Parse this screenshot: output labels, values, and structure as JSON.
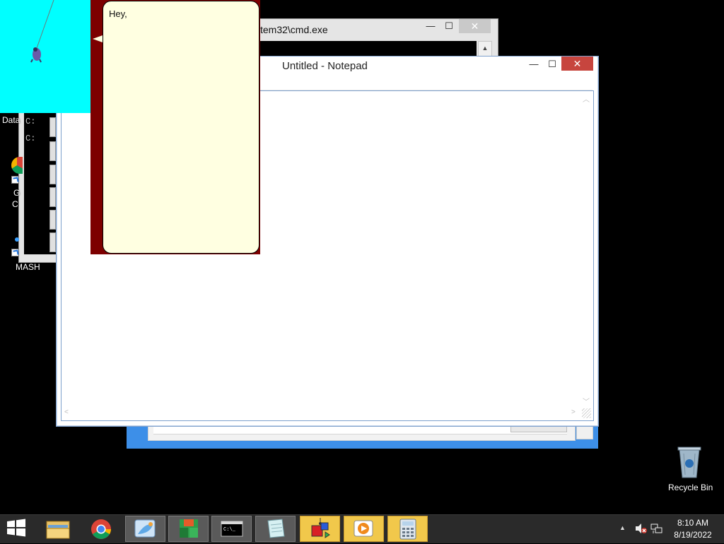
{
  "desktop": {
    "icons": [
      {
        "label": "Data",
        "icon": "data-icon"
      },
      {
        "label": "G",
        "label2": "C",
        "icon": "chrome-shortcut-icon"
      },
      {
        "label": "MASH",
        "icon": "mash-shortcut-icon"
      },
      {
        "label": "Recycle Bin",
        "icon": "recycle-bin-icon"
      }
    ]
  },
  "cmd": {
    "title": "tem32\\cmd.exe",
    "lines": [
      "C:",
      "C:"
    ],
    "close_glyph": "✕",
    "min_glyph": "—",
    "max_glyph": "☐"
  },
  "notepad": {
    "title": "Untitled - Notepad",
    "content": "",
    "close_glyph": "✕",
    "min_glyph": "—",
    "max_glyph": "☐"
  },
  "agent": {
    "balloon_text": "Hey,",
    "character": "rocky-character-icon"
  },
  "taskbar": {
    "apps": [
      {
        "name": "file-explorer",
        "icon": "folder-icon",
        "state": "normal"
      },
      {
        "name": "chrome",
        "icon": "chrome-icon",
        "state": "normal"
      },
      {
        "name": "paint",
        "icon": "paint-icon",
        "state": "active-gray"
      },
      {
        "name": "boxes-app",
        "icon": "boxes-icon",
        "state": "active-gray"
      },
      {
        "name": "command-prompt",
        "icon": "cmd-icon",
        "state": "active-gray"
      },
      {
        "name": "notepad",
        "icon": "notepad-icon",
        "state": "active-gray"
      },
      {
        "name": "shapes-app",
        "icon": "shapes-icon",
        "state": "active-yellow"
      },
      {
        "name": "media-player",
        "icon": "media-player-icon",
        "state": "active-yellow"
      },
      {
        "name": "calculator",
        "icon": "calculator-icon",
        "state": "active-yellow"
      }
    ],
    "clock": {
      "time": "8:10 AM",
      "date": "8/19/2022"
    }
  },
  "colors": {
    "accent_blue": "#3d8fe8",
    "agent_cyan": "#00ffff",
    "agent_red": "#7d0000",
    "balloon": "#ffffe1",
    "close_red": "#c7453e",
    "taskbar": "#2a2a2a"
  }
}
